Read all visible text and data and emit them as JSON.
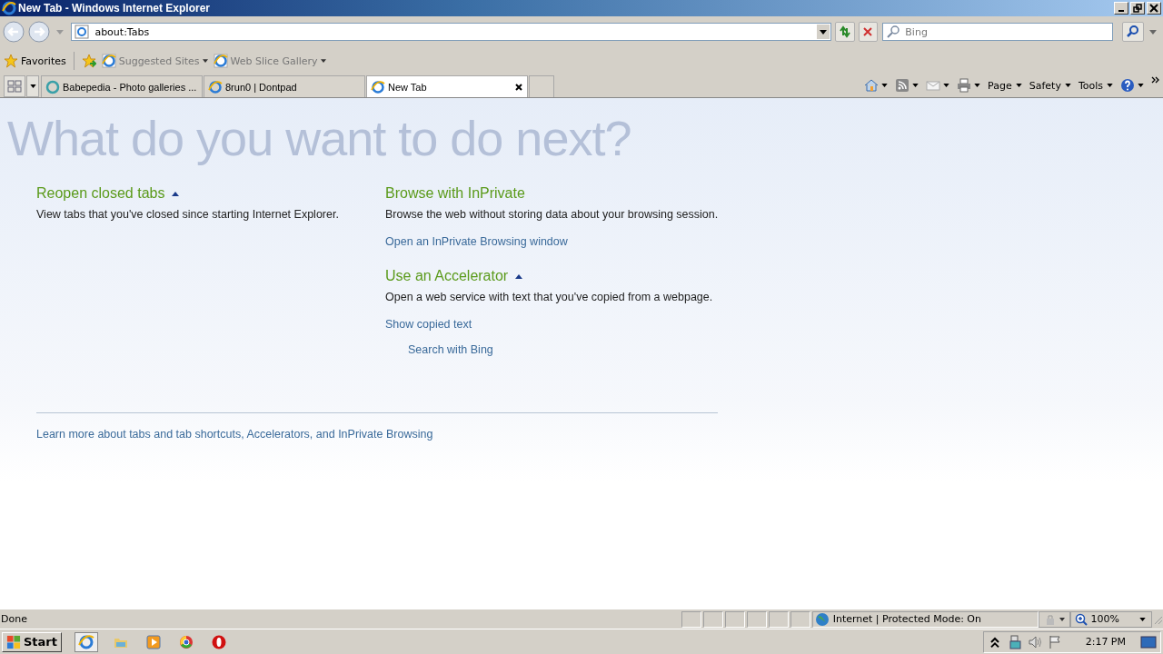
{
  "window": {
    "title": "New Tab - Windows Internet Explorer"
  },
  "address": {
    "value": "about:Tabs"
  },
  "search": {
    "placeholder": "Bing"
  },
  "favorites": {
    "label": "Favorites",
    "links": [
      {
        "label": "Suggested Sites"
      },
      {
        "label": "Web Slice Gallery"
      }
    ]
  },
  "tabs": [
    {
      "title": "Babepedia - Photo galleries ...",
      "selected": false,
      "kind": "ring"
    },
    {
      "title": "8run0 | Dontpad",
      "selected": false,
      "kind": "ie"
    },
    {
      "title": "New Tab",
      "selected": true,
      "kind": "ie"
    }
  ],
  "commands": [
    "Page",
    "Safety",
    "Tools"
  ],
  "content": {
    "heading": "What do you want to do next?",
    "columns": [
      [
        {
          "title": "Reopen closed tabs",
          "expanded": true,
          "description": "View tabs that you've closed since starting Internet Explorer."
        }
      ],
      [
        {
          "title": "Browse with InPrivate",
          "description": "Browse the web without storing data about your browsing session.",
          "links": [
            {
              "label": "Open an InPrivate Browsing window"
            }
          ]
        },
        {
          "title": "Use an Accelerator",
          "expanded": true,
          "description": "Open a web service with text that you've copied from a webpage.",
          "links": [
            {
              "label": "Show copied text",
              "children": [
                {
                  "label": "Search with Bing"
                }
              ]
            }
          ]
        }
      ]
    ],
    "footer_link": "Learn more about tabs and tab shortcuts, Accelerators, and InPrivate Browsing"
  },
  "status_bar": {
    "text": "Done",
    "zone": "Internet | Protected Mode: On",
    "zoom": "100%"
  },
  "taskbar": {
    "start": "Start",
    "clock": "2:17 PM"
  }
}
